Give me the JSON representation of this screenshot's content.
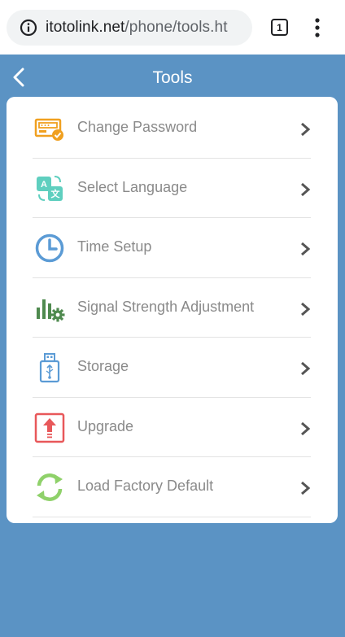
{
  "browser": {
    "url_domain": "itotolink.net",
    "url_path": "/phone/tools.ht",
    "tab_count": "1"
  },
  "header": {
    "title": "Tools"
  },
  "menu": {
    "items": [
      {
        "label": "Change Password",
        "icon": "password-icon"
      },
      {
        "label": "Select Language",
        "icon": "language-icon"
      },
      {
        "label": "Time Setup",
        "icon": "clock-icon"
      },
      {
        "label": "Signal Strength Adjustment",
        "icon": "signal-settings-icon"
      },
      {
        "label": "Storage",
        "icon": "usb-storage-icon"
      },
      {
        "label": "Upgrade",
        "icon": "upgrade-icon"
      },
      {
        "label": "Load Factory Default",
        "icon": "reset-icon"
      }
    ]
  },
  "colors": {
    "background": "#5b93c4",
    "password_icon": "#f0a020",
    "language_icon": "#5fcfbf",
    "clock_icon": "#5b9bd5",
    "signal_icon": "#4f8a4f",
    "storage_icon": "#5b9bd5",
    "upgrade_icon": "#e8585a",
    "reset_icon": "#8fd16a"
  }
}
